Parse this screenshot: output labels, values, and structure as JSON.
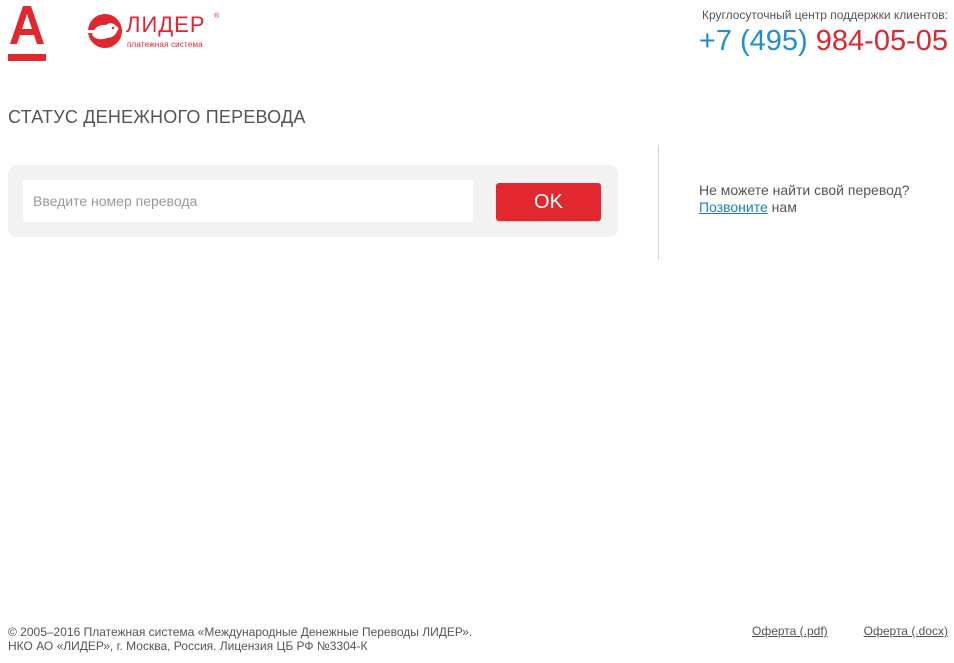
{
  "header": {
    "lider_logo_word": "ЛИДЕР",
    "lider_logo_reg": "®",
    "lider_logo_sub": "платежная система",
    "support_label": "Круглосуточный центр поддержки клиентов:",
    "phone_code": "+7 (495)",
    "phone_number": "984-05-05"
  },
  "main": {
    "title": "СТАТУС ДЕНЕЖНОГО ПЕРЕВОДА",
    "search_placeholder": "Введите номер перевода",
    "search_value": "",
    "ok_label": "OK"
  },
  "help": {
    "question": "Не можете найти свой перевод?",
    "call_link": "Позвоните",
    "call_suffix": " нам"
  },
  "footer": {
    "copyright_line1": "© 2005–2016 Платежная система «Международные Денежные Переводы ЛИДЕР».",
    "copyright_line2": "НКО АО «ЛИДЕР», г. Москва, Россия. Лицензия ЦБ РФ №3304-К",
    "offer_pdf": "Оферта (.pdf)",
    "offer_docx": "Оферта (.docx)"
  },
  "colors": {
    "brand_red": "#e0262e",
    "phone_blue": "#1f8fd0",
    "panel_bg": "#f2f2f2"
  },
  "icons": {
    "alfa_logo": "alfa-bank-logo",
    "lider_logo": "lider-bear-logo"
  }
}
